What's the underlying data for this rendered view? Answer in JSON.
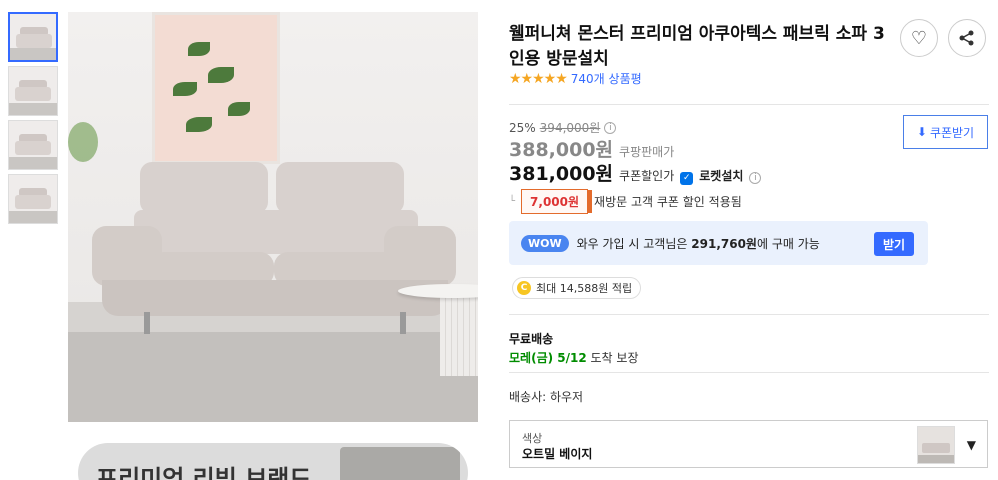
{
  "product": {
    "title": "웰퍼니쳐 몬스터 프리미엄 아쿠아텍스 패브릭 소파 3인용 방문설치",
    "rating_stars": "★★★★★",
    "review_count": "740개 상품평"
  },
  "price": {
    "discount_rate": "25%",
    "original_price": "394,000원",
    "coupang_price": "388,000원",
    "coupang_price_label": "쿠팡판매가",
    "coupon_price": "381,000원",
    "coupon_price_label": "쿠폰할인가",
    "rocket_label": "로켓설치",
    "coupon_download": "쿠폰받기",
    "coupon_amount": "7,000원",
    "coupon_note": "재방문 고객 쿠폰 할인 적용됨"
  },
  "wow": {
    "badge": "WOW",
    "text_prefix": "와우 가입 시 고객님은",
    "price": "291,760원",
    "text_suffix": "에 구매 가능",
    "button": "받기"
  },
  "points": {
    "coin": "C",
    "text": "최대 14,588원 적립"
  },
  "shipping": {
    "title": "무료배송",
    "date": "모레(금) 5/12",
    "date_suffix": " 도착 보장",
    "seller": "배송사: 하우저"
  },
  "option": {
    "label": "색상",
    "value": "오트밀 베이지"
  },
  "banner": {
    "text": "프리미엄 리빙 브랜드"
  },
  "icons": {
    "heart": "♡",
    "share": "share-icon",
    "info": "i",
    "download": "⬇",
    "caret": "▼"
  },
  "colors": {
    "accent": "#346aff",
    "rating_star": "#f5a623",
    "delivery_green": "#008c00",
    "coupon_red": "#e36b2c"
  }
}
